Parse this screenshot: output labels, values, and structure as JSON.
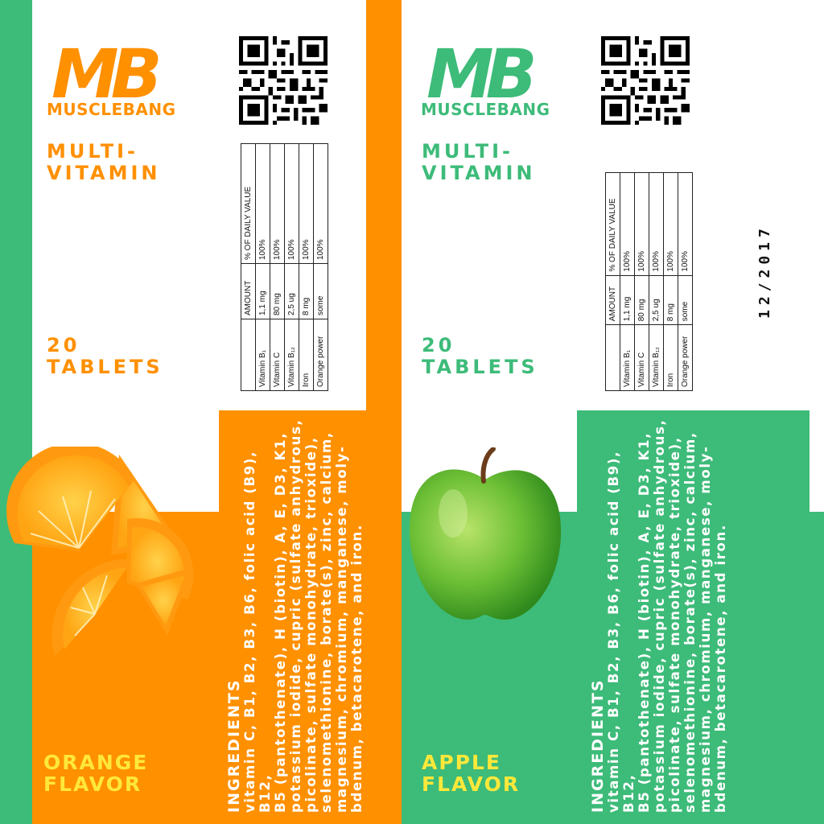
{
  "colors": {
    "orange": "#ff9000",
    "green": "#3dbb79",
    "yellow": "#ffe83a",
    "white": "#ffffff"
  },
  "left_label": {
    "logo_letters": "MB",
    "brand": "MUSCLEBANG",
    "product_line1": "MULTI-",
    "product_line2": "VITAMIN",
    "count_line1": "20",
    "count_line2": "TABLETS",
    "flavor_line1": "ORANGE",
    "flavor_line2": "FLAVOR",
    "fruit_icon": "orange-slices-icon"
  },
  "right_label": {
    "logo_letters": "MB",
    "brand": "MUSCLEBANG",
    "product_line1": "MULTI-",
    "product_line2": "VITAMIN",
    "count_line1": "20",
    "count_line2": "TABLETS",
    "flavor_line1": "APPLE",
    "flavor_line2": "FLAVOR",
    "fruit_icon": "green-apple-icon",
    "date": "12/2017"
  },
  "nutrition": {
    "headers": [
      "",
      "AMOUNT",
      "% OF DAILY VALUE"
    ],
    "rows": [
      [
        "Vitamin B₁",
        "1,1 mg",
        "100%"
      ],
      [
        "Vitamin C",
        "80 mg",
        "100%"
      ],
      [
        "Vitamin B₁₂",
        "2,5 ug",
        "100%"
      ],
      [
        "Iron",
        "8 mg",
        "100%"
      ],
      [
        "Orange power",
        "some",
        "100%"
      ]
    ]
  },
  "ingredients": {
    "lines": [
      "INGREDIENTS",
      "vitamin C, B1, B2, B3, B6, folic acid (B9), B12,",
      "B5 (pantothenate), H (biotin), A, E, D3, K1,",
      "potassium iodide, cupric (sulfate anhydrous,",
      "picolinate, sulfate monohydrate, trioxide),",
      "selenomethionine, borate(s), zinc, calcium,",
      "magnesium, chromium, manganese, moly-",
      "bdenum, betacarotene, and iron."
    ]
  }
}
